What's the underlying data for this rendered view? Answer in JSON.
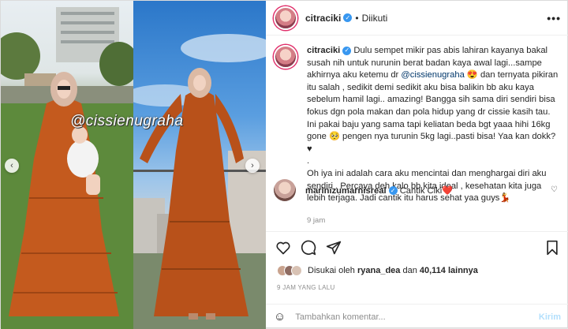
{
  "media": {
    "watermark": "@cissienugraha",
    "prev_icon": "chevron-left-icon",
    "next_icon": "chevron-right-icon"
  },
  "header": {
    "username": "citraciki",
    "separator": "•",
    "follow_status": "Diikuti",
    "more_icon": "more-options-icon",
    "more_glyph": "•••"
  },
  "caption": {
    "username": "citraciki",
    "text_1": " Dulu sempet mikir pas abis lahiran kayanya bakal susah nih untuk nurunin berat badan kaya awal lagi...sampe akhirnya aku ketemu dr ",
    "mention": "@cissienugraha",
    "text_2": " 😍 dan ternyata pikiran itu salah , sedikit demi sedikit aku bisa balikin bb aku kaya sebelum hamil lagi.. amazing! Bangga sih sama diri sendiri bisa fokus dgn pola makan dan pola hidup yang dr cissie kasih tau. Ini pakai baju yang sama tapi keliatan beda bgt yaaa hihi 16kg gone 🥺 pengen nya turunin 5kg lagi..pasti bisa! Yaa kan dokk?♥",
    "line_dot": ".",
    "text_3": "Oh iya ini adalah cara aku mencintai dan menghargai diri aku sendiri . Percaya deh kalo bb kita ideal , kesehatan kita juga lebih terjaga. Jadi cantik itu harus sehat yaa guys💃",
    "time": "9 jam"
  },
  "comment": {
    "username": "marinizumarnisreal",
    "text": " Cantik Ciki",
    "heart": "❤️",
    "like_icon": "heart-outline-icon"
  },
  "actions": {
    "like_icon": "heart-icon",
    "comment_icon": "comment-icon",
    "share_icon": "share-icon",
    "save_icon": "bookmark-icon"
  },
  "likes": {
    "prefix": "Disukai oleh ",
    "user": "ryana_dea",
    "middle": " dan ",
    "count": "40,114 lainnya"
  },
  "date": "9 JAM YANG LALU",
  "add_comment": {
    "emoji_icon": "emoji-icon",
    "placeholder": "Tambahkan komentar...",
    "post_label": "Kirim"
  },
  "colors": {
    "dress": "#c45a1e",
    "verified": "#3897f0",
    "link": "#00376b",
    "post_disabled": "#b2dffc"
  }
}
